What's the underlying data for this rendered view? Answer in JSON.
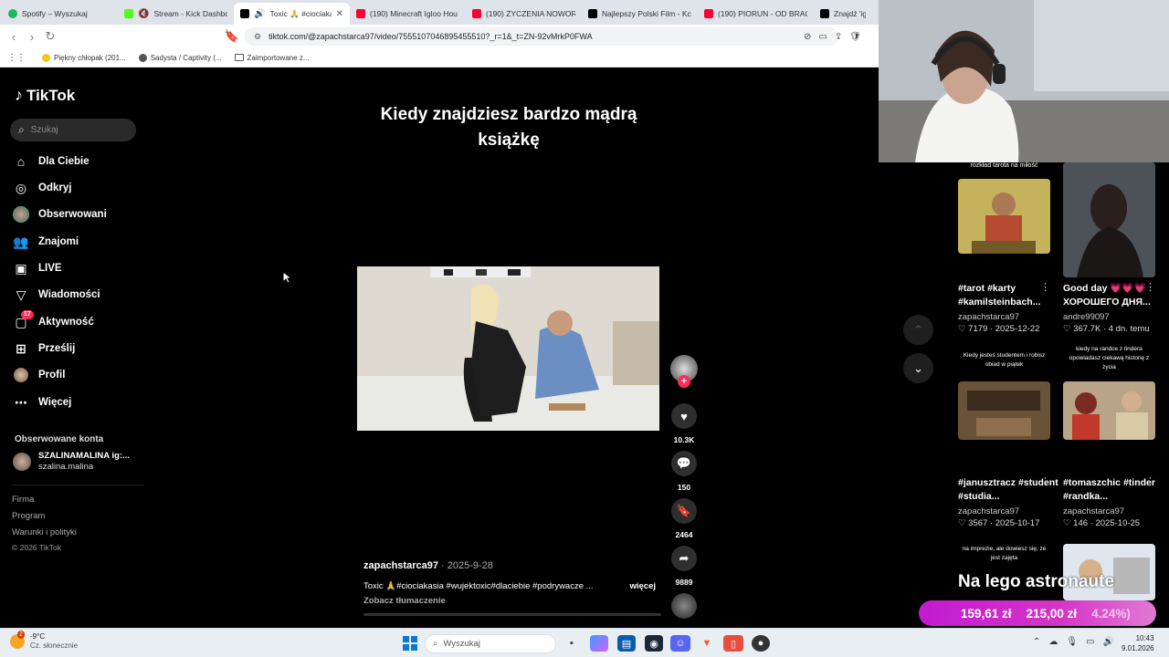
{
  "browser": {
    "tabs": [
      {
        "title": "Spotify – Wyszukaj",
        "color": "#1db954",
        "active": false
      },
      {
        "title": "Stream - Kick Dashboa",
        "color": "#53fc18",
        "active": false
      },
      {
        "title": "Toxic 🙏 #ciociaka",
        "color": "#000000",
        "active": true
      },
      {
        "title": "(190) Minecraft Igloo Hou",
        "color": "#ff0033",
        "active": false
      },
      {
        "title": "(190) ŻYCZENIA NOWORO",
        "color": "#ff0033",
        "active": false
      },
      {
        "title": "Najlepszy Polski Film - Kc",
        "color": "#000000",
        "active": false
      },
      {
        "title": "(190) PIORUN - OD BRAC",
        "color": "#ff0033",
        "active": false
      },
      {
        "title": "Znajdź 'igloo'",
        "color": "#000000",
        "active": false
      }
    ],
    "url": "tiktok.com/@zapachstarca97/video/7555107046895455510?_r=1&_t=ZN-92vMrkP0FWA",
    "bookmarks": [
      {
        "label": "Piękny chłopak (201..."
      },
      {
        "label": "Sadysta / Captivity (..."
      },
      {
        "label": "Zaimportowane z..."
      }
    ]
  },
  "sidebar": {
    "logo": "TikTok",
    "search_placeholder": "Szukaj",
    "nav": [
      {
        "label": "Dla Ciebie",
        "icon": "home-icon"
      },
      {
        "label": "Odkryj",
        "icon": "compass-icon"
      },
      {
        "label": "Obserwowani",
        "icon": "avatar-icon"
      },
      {
        "label": "Znajomi",
        "icon": "friends-icon"
      },
      {
        "label": "LIVE",
        "icon": "live-icon"
      },
      {
        "label": "Wiadomości",
        "icon": "messages-icon"
      },
      {
        "label": "Aktywność",
        "icon": "activity-icon",
        "badge": "17"
      },
      {
        "label": "Prześlij",
        "icon": "upload-icon"
      },
      {
        "label": "Profil",
        "icon": "profile-icon"
      },
      {
        "label": "Więcej",
        "icon": "more-icon"
      }
    ],
    "followed_heading": "Obserwowane konta",
    "followed": {
      "name": "SZALINAMALINA ig:...",
      "handle": "szalina.malina"
    },
    "footer": [
      "Firma",
      "Program",
      "Warunki i polityki",
      "© 2026 TikTok"
    ]
  },
  "video": {
    "overlay_text": "Kiedy znajdziesz bardzo mądrą książkę",
    "author": "zapachstarca97",
    "date": "2025-9-28",
    "description": "Toxic 🙏#ciociakasia #wujektoxic#dlaciebie #podrywacze ...",
    "more": "więcej",
    "translate": "Zobacz tłumaczenie",
    "likes": "10.3K",
    "comments": "150",
    "saves": "2464",
    "shares": "9889"
  },
  "related": [
    {
      "top_text": "rozkład tarota na miłość",
      "title": "#tarot #karty #kamilsteinbach...",
      "author": "zapachstarca97",
      "likes": "7179",
      "date": "2025-12-22"
    },
    {
      "top_text": "",
      "title": "Good day 💗💗💗 ХОРОШЕГО ДНЯ...",
      "author": "andre99097",
      "likes": "367.7K",
      "date": "4 dn. temu"
    },
    {
      "top_text": "Kiedy jesteś studentem i robisz obiad w piątek",
      "title": "#janusztracz #student #studia...",
      "author": "zapachstarca97",
      "likes": "3567",
      "date": "2025-10-17"
    },
    {
      "top_text": "kiedy na randce z tindera opowiadasz ciekawą historię z życia",
      "title": "#tomaszchic #tinder #randka...",
      "author": "zapachstarca97",
      "likes": "146",
      "date": "2025-10-25"
    },
    {
      "top_text": "na imprezie, ale dowiesz się, że jest zajęta",
      "title": "",
      "author": "",
      "likes": "",
      "date": ""
    }
  ],
  "overlay": {
    "banner_text": "Na lego astronaute",
    "price_1": "159,61 zł",
    "price_2": "215,00 zł",
    "percent": "4.24%)"
  },
  "taskbar": {
    "weather_temp": "-9°C",
    "weather_desc": "Cz. słonecznie",
    "weather_badge": "2",
    "search_placeholder": "Wyszukaj",
    "time": "10:43",
    "date": "9.01.2026"
  },
  "colors": {
    "tiktok_red": "#fe2c55",
    "bg": "#000000",
    "price_pink": "#c21bd0"
  }
}
